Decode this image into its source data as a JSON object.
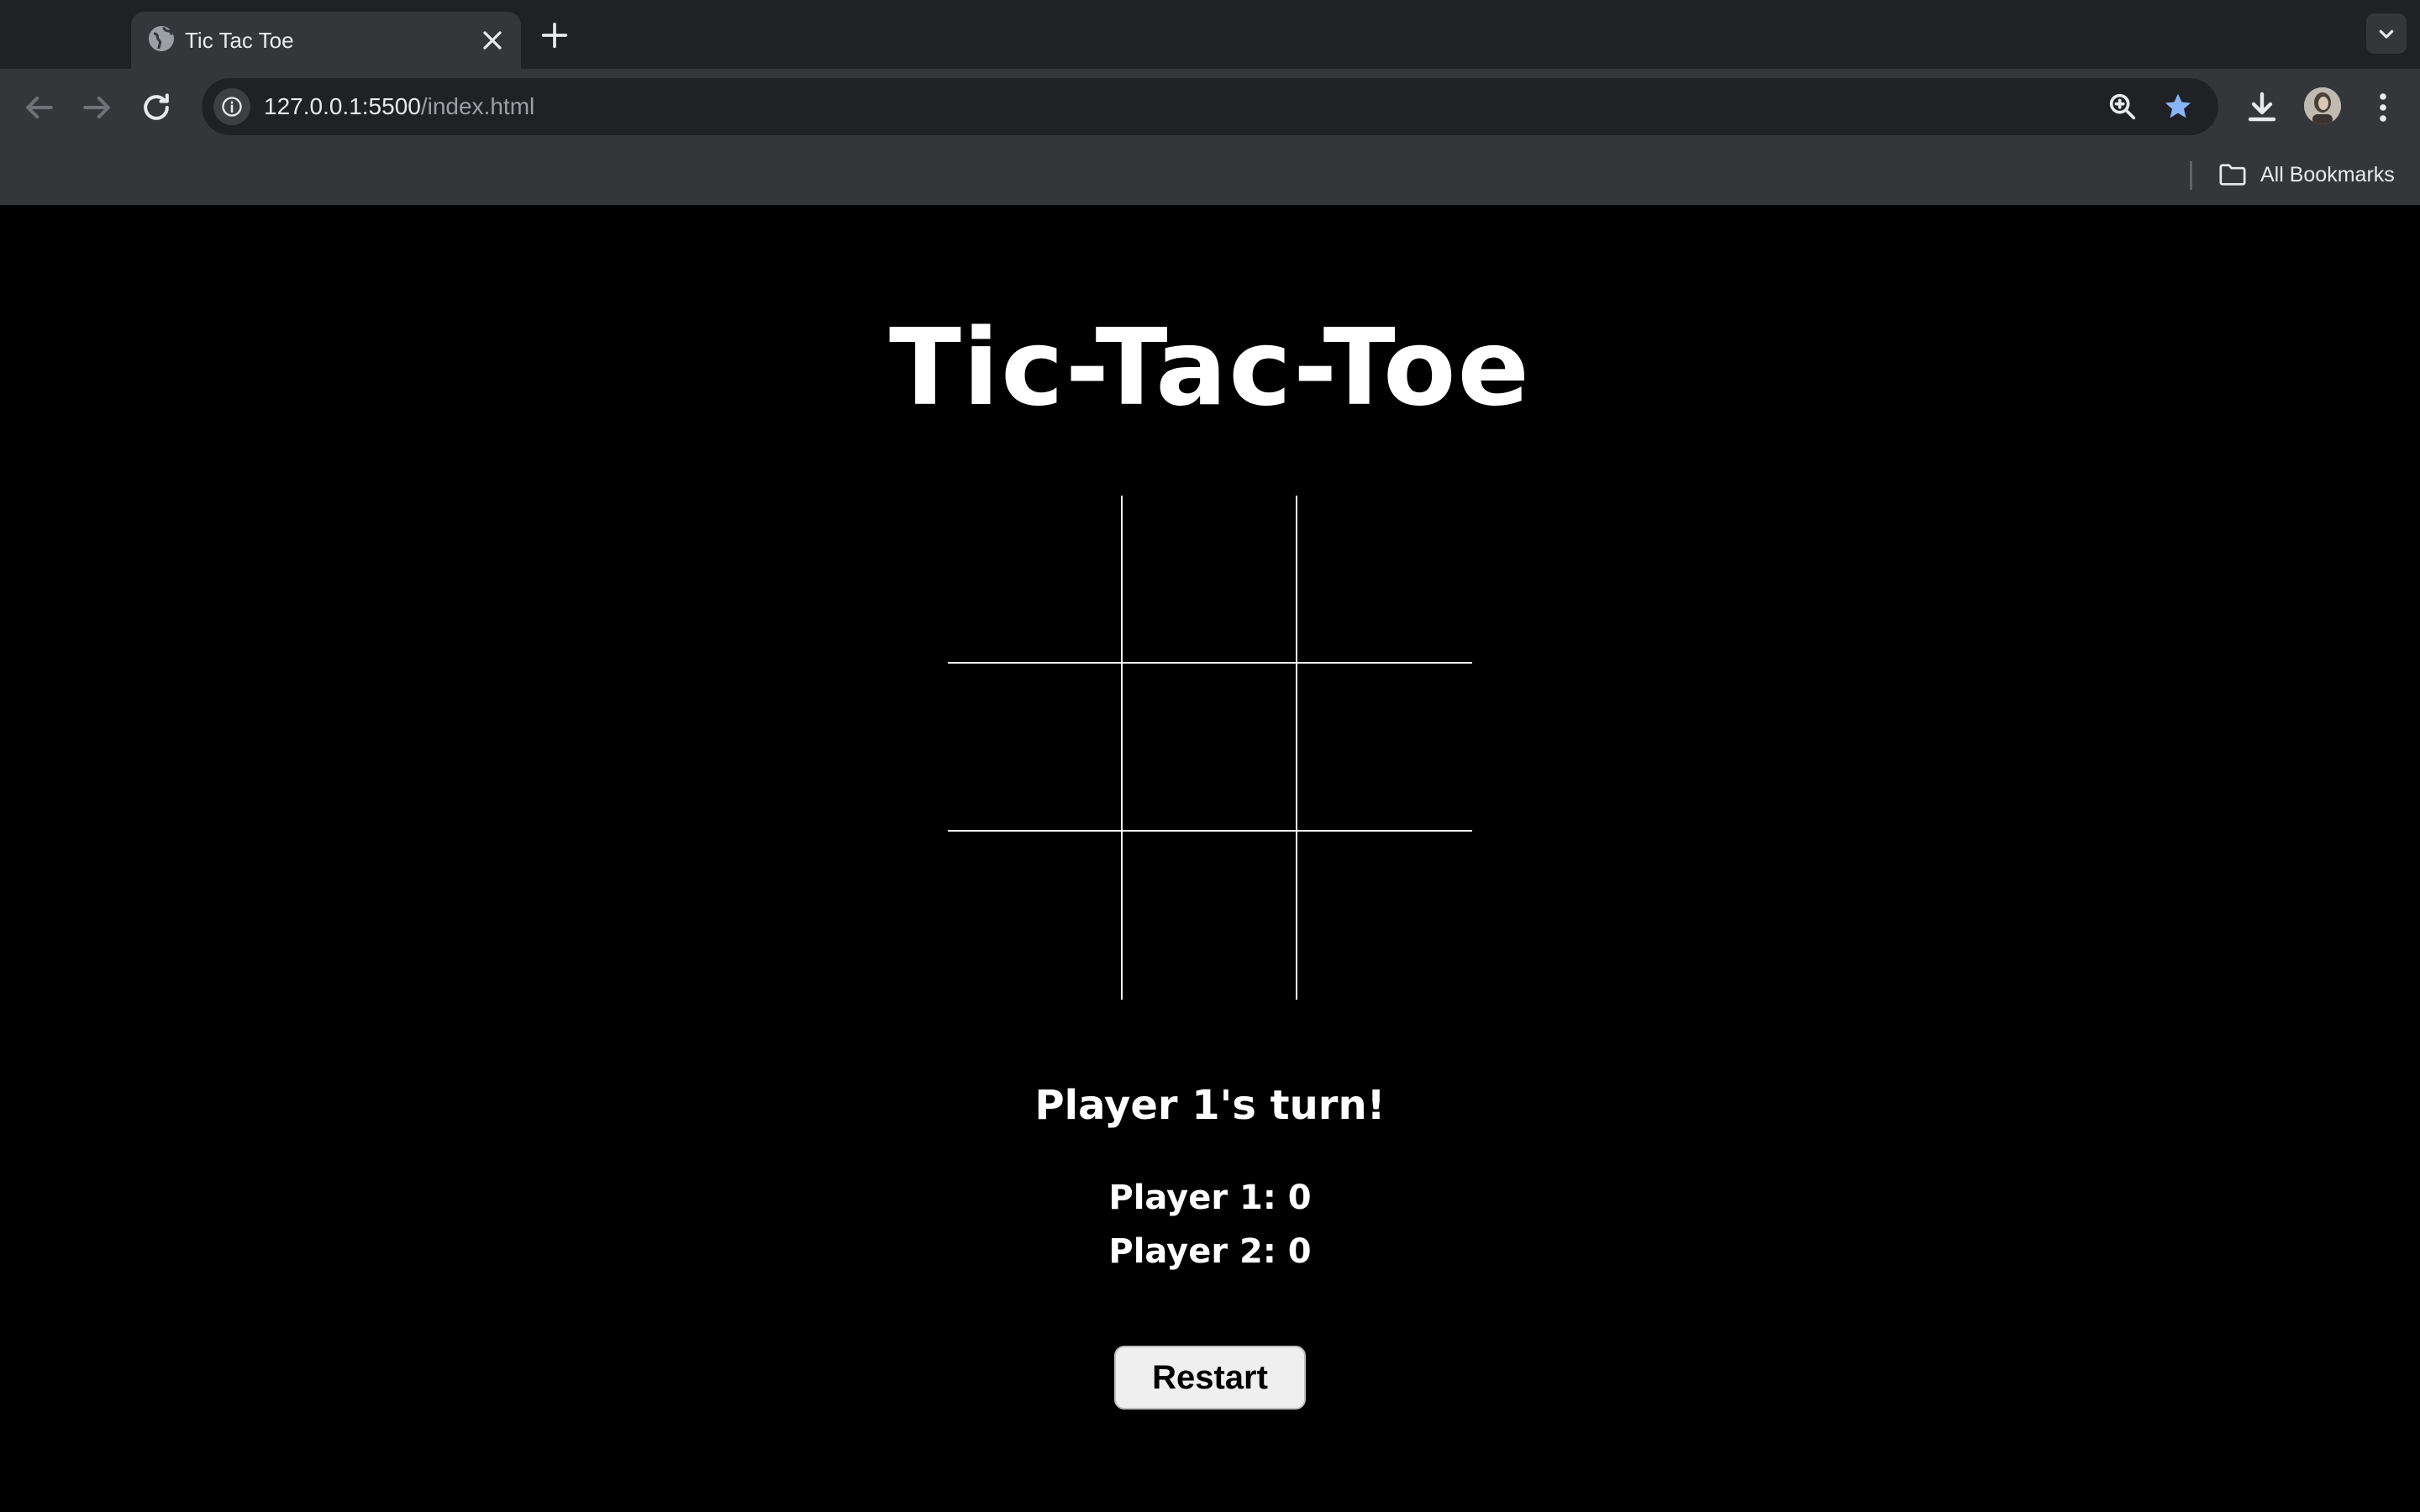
{
  "browser": {
    "tab": {
      "title": "Tic Tac Toe",
      "favicon": "globe-icon"
    },
    "omnibox": {
      "host": "127.0.0.1:5500",
      "path": "/index.html"
    },
    "bookmarks": {
      "all_label": "All Bookmarks"
    },
    "colors": {
      "star": "#8ab4f8"
    }
  },
  "game": {
    "title": "Tic-Tac-Toe",
    "board": [
      "",
      "",
      "",
      "",
      "",
      "",
      "",
      "",
      ""
    ],
    "status": "Player 1's turn!",
    "scores": [
      {
        "label": "Player 1: 0"
      },
      {
        "label": "Player 2: 0"
      }
    ],
    "restart_label": "Restart"
  }
}
